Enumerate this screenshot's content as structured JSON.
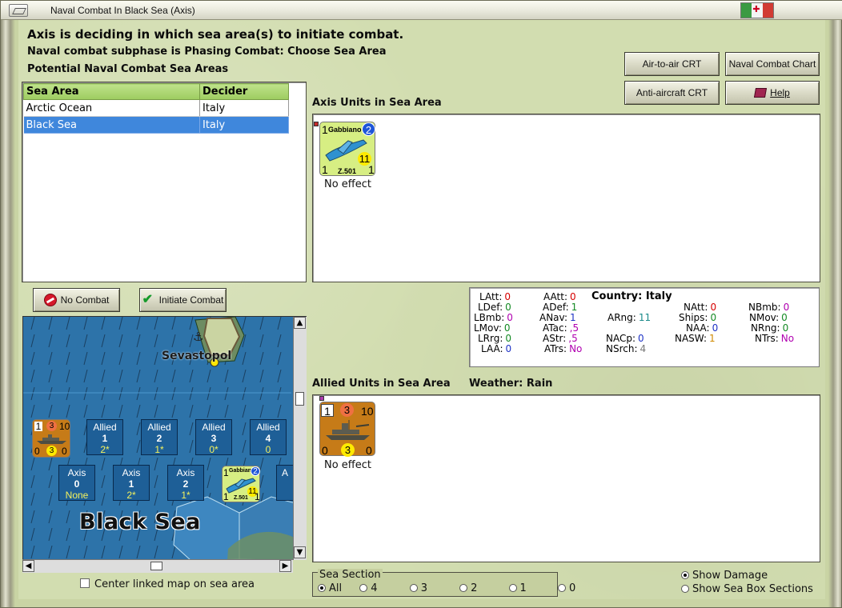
{
  "window": {
    "title": "Naval Combat In Black Sea (Axis)"
  },
  "header": {
    "status": "Axis is deciding in which sea area(s) to initiate combat.",
    "subphase": "Naval combat subphase is Phasing Combat: Choose Sea Area",
    "areas_title": "Potential Naval Combat Sea Areas"
  },
  "buttons": {
    "air_to_air": "Air-to-air CRT",
    "naval_chart": "Naval Combat Chart",
    "anti_aircraft": "Anti-aircraft CRT",
    "help": "Help",
    "no_combat": "No Combat",
    "initiate_combat": "Initiate Combat"
  },
  "sea_table": {
    "columns": [
      "Sea Area",
      "Decider"
    ],
    "rows": [
      {
        "area": "Arctic Ocean",
        "decider": "Italy"
      },
      {
        "area": "Black Sea",
        "decider": "Italy"
      }
    ]
  },
  "axis_units": {
    "title": "Axis Units in Sea Area",
    "unit": {
      "name": "Gabbiano",
      "top_left": "1",
      "top_right": "2",
      "middle_right": "11",
      "bottom_left": "1",
      "model": "Z.501",
      "bottom_right": "1",
      "result": "No effect"
    }
  },
  "stats": {
    "country_label": "Country:",
    "country": "Italy",
    "items": [
      {
        "label": "LAtt:",
        "value": "0",
        "color": "#d60000"
      },
      {
        "label": "AAtt:",
        "value": "0",
        "color": "#d60000"
      },
      {
        "label": "LDef:",
        "value": "0",
        "color": "#148a24"
      },
      {
        "label": "ADef:",
        "value": "1",
        "color": "#148a24"
      },
      {
        "label": "NAtt:",
        "value": "0",
        "color": "#d60000"
      },
      {
        "label": "NBmb:",
        "value": "0",
        "color": "#b000b0"
      },
      {
        "label": "LBmb:",
        "value": "0",
        "color": "#b000b0"
      },
      {
        "label": "ANav:",
        "value": "1",
        "color": "#1f34c6"
      },
      {
        "label": "ARng:",
        "value": "11",
        "color": "#1b8a8a"
      },
      {
        "label": "Ships:",
        "value": "0",
        "color": "#148a24"
      },
      {
        "label": "NMov:",
        "value": "0",
        "color": "#148a24"
      },
      {
        "label": "LMov:",
        "value": "0",
        "color": "#148a24"
      },
      {
        "label": "ATac:",
        "value": ",5",
        "color": "#b000b0"
      },
      {
        "label": "NAA:",
        "value": "0",
        "color": "#1f34c6"
      },
      {
        "label": "NRng:",
        "value": "0",
        "color": "#148a24"
      },
      {
        "label": "LRrg:",
        "value": "0",
        "color": "#148a24"
      },
      {
        "label": "AStr:",
        "value": ",5",
        "color": "#b000b0"
      },
      {
        "label": "NACp:",
        "value": "0",
        "color": "#1f34c6"
      },
      {
        "label": "NASW:",
        "value": "1",
        "color": "#d08a00"
      },
      {
        "label": "NTrs:",
        "value": "No",
        "color": "#b000b0"
      },
      {
        "label": "LAA:",
        "value": "0",
        "color": "#1f34c6"
      },
      {
        "label": "ATrs:",
        "value": "No",
        "color": "#b000b0"
      },
      {
        "label": "NSrch:",
        "value": "4",
        "color": "#777777"
      }
    ]
  },
  "allied_units": {
    "title": "Allied Units in Sea Area",
    "weather_label": "Weather:",
    "weather": "Rain",
    "unit": {
      "top_left": "1",
      "top_mid": "3",
      "top_right": "10",
      "bottom_left": "0",
      "bottom_mid": "3",
      "bottom_right": "0",
      "result": "No effect"
    }
  },
  "map": {
    "city": "Sevastopol",
    "sea_label": "Black Sea",
    "allied_boxes": [
      {
        "side": "Allied",
        "num": "1",
        "status": "2*"
      },
      {
        "side": "Allied",
        "num": "2",
        "status": "1*"
      },
      {
        "side": "Allied",
        "num": "3",
        "status": "0*"
      },
      {
        "side": "Allied",
        "num": "4",
        "status": "0"
      }
    ],
    "axis_boxes": [
      {
        "side": "Axis",
        "num": "0",
        "status": "None"
      },
      {
        "side": "Axis",
        "num": "1",
        "status": "2*"
      },
      {
        "side": "Axis",
        "num": "2",
        "status": "1*"
      }
    ],
    "partial_axis_box": "A",
    "map_ship": {
      "top_left": "1",
      "top_mid": "3",
      "top_right": "10",
      "bottom_left": "0",
      "bottom_mid": "3",
      "bottom_right": "0"
    },
    "map_aircraft": {
      "name": "Gabbiano",
      "top_left": "1",
      "top_right": "2",
      "middle_right": "11",
      "bottom_left": "1",
      "model": "Z.501",
      "bottom_right": "1"
    }
  },
  "controls": {
    "center_linked_map": "Center linked map on sea area",
    "sea_section_label": "Sea Section",
    "sea_sections": [
      "All",
      "4",
      "3",
      "2",
      "1",
      "0"
    ],
    "show_damage": "Show Damage",
    "show_sea_box_sections": "Show Sea Box Sections"
  }
}
